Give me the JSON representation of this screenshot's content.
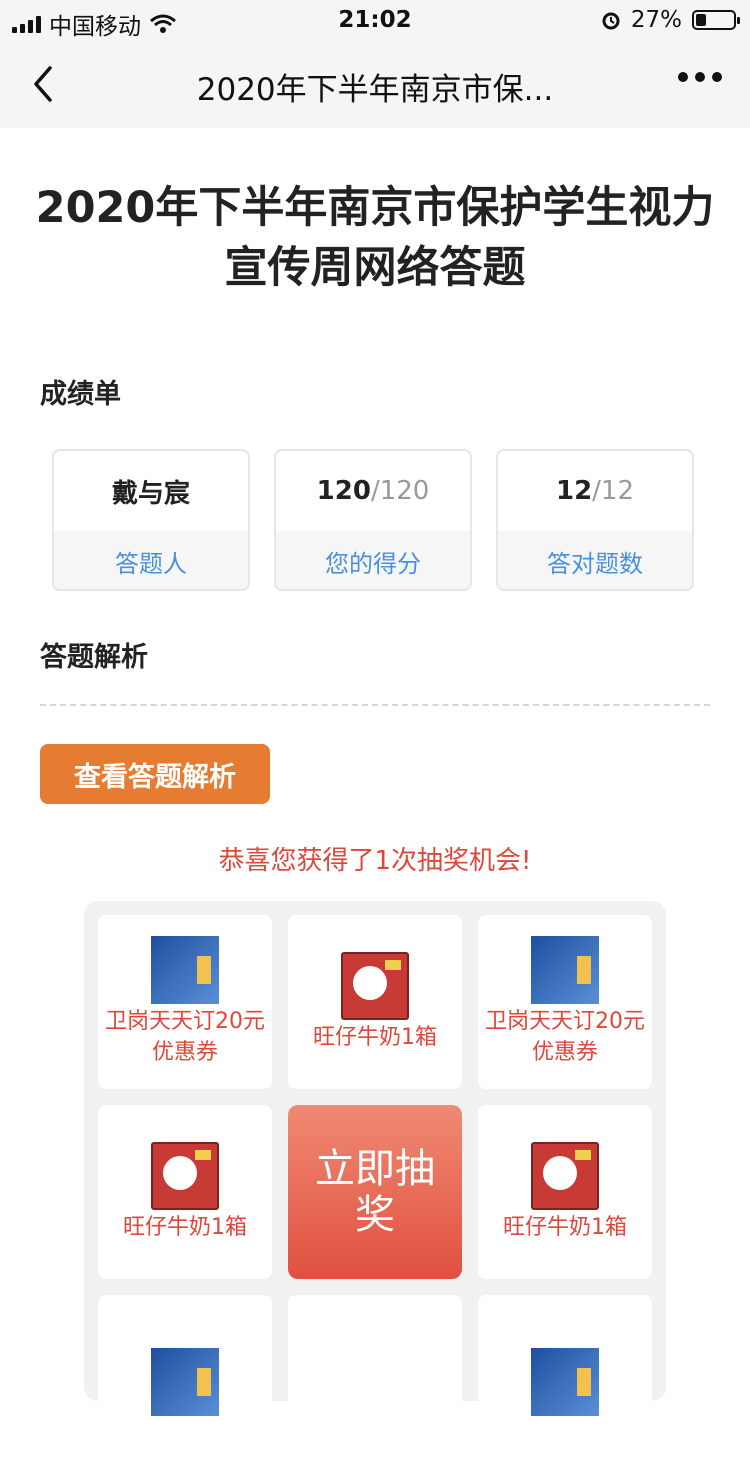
{
  "status": {
    "carrier": "中国移动",
    "time": "21:02",
    "battery": "27%"
  },
  "nav": {
    "title": "2020年下半年南京市保..."
  },
  "page": {
    "title": "2020年下半年南京市保护学生视力宣传周网络答题"
  },
  "score": {
    "section_label": "成绩单",
    "cards": [
      {
        "value": "戴与宸",
        "label": "答题人"
      },
      {
        "value_main": "120",
        "value_total": "/120",
        "label": "您的得分"
      },
      {
        "value_main": "12",
        "value_total": "/12",
        "label": "答对题数"
      }
    ]
  },
  "analysis": {
    "section_label": "答题解析",
    "button": "查看答题解析"
  },
  "lottery": {
    "congrats": "恭喜您获得了1次抽奖机会!",
    "prizes": [
      {
        "name": "卫岗天天订20元优惠券",
        "icon": "coupon-image"
      },
      {
        "name": "旺仔牛奶1箱",
        "icon": "milk-box-image"
      },
      {
        "name": "卫岗天天订20元优惠券",
        "icon": "coupon-image"
      },
      {
        "name": "旺仔牛奶1箱",
        "icon": "milk-box-image"
      },
      {
        "name": "旺仔牛奶1箱",
        "icon": "milk-box-image"
      }
    ],
    "draw_button": "立即抽奖"
  }
}
